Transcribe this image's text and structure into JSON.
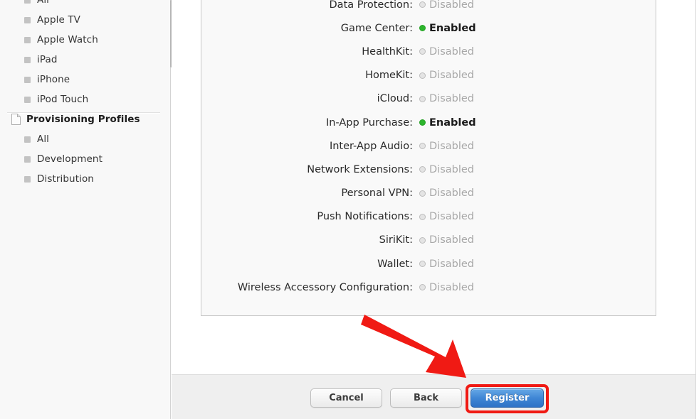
{
  "sidebar": {
    "items": [
      {
        "label": "All",
        "icon": "square-bullet-icon",
        "type": "child"
      },
      {
        "label": "Apple TV",
        "icon": "square-bullet-icon",
        "type": "child"
      },
      {
        "label": "Apple Watch",
        "icon": "square-bullet-icon",
        "type": "child"
      },
      {
        "label": "iPad",
        "icon": "square-bullet-icon",
        "type": "child"
      },
      {
        "label": "iPhone",
        "icon": "square-bullet-icon",
        "type": "child"
      },
      {
        "label": "iPod Touch",
        "icon": "square-bullet-icon",
        "type": "child"
      },
      {
        "label": "Provisioning Profiles",
        "icon": "document-icon",
        "type": "header"
      },
      {
        "label": "All",
        "icon": "square-bullet-icon",
        "type": "child"
      },
      {
        "label": "Development",
        "icon": "square-bullet-icon",
        "type": "child"
      },
      {
        "label": "Distribution",
        "icon": "square-bullet-icon",
        "type": "child"
      }
    ]
  },
  "capabilities": {
    "enabled_label": "Enabled",
    "disabled_label": "Disabled",
    "rows": [
      {
        "name": "Data Protection:",
        "state": "Disabled",
        "enabled": false
      },
      {
        "name": "Game Center:",
        "state": "Enabled",
        "enabled": true
      },
      {
        "name": "HealthKit:",
        "state": "Disabled",
        "enabled": false
      },
      {
        "name": "HomeKit:",
        "state": "Disabled",
        "enabled": false
      },
      {
        "name": "iCloud:",
        "state": "Disabled",
        "enabled": false
      },
      {
        "name": "In-App Purchase:",
        "state": "Enabled",
        "enabled": true
      },
      {
        "name": "Inter-App Audio:",
        "state": "Disabled",
        "enabled": false
      },
      {
        "name": "Network Extensions:",
        "state": "Disabled",
        "enabled": false
      },
      {
        "name": "Personal VPN:",
        "state": "Disabled",
        "enabled": false
      },
      {
        "name": "Push Notifications:",
        "state": "Disabled",
        "enabled": false
      },
      {
        "name": "SiriKit:",
        "state": "Disabled",
        "enabled": false
      },
      {
        "name": "Wallet:",
        "state": "Disabled",
        "enabled": false
      },
      {
        "name": "Wireless Accessory Configuration:",
        "state": "Disabled",
        "enabled": false
      }
    ]
  },
  "footer": {
    "cancel_label": "Cancel",
    "back_label": "Back",
    "register_label": "Register"
  },
  "annotation": {
    "arrow_color": "#f01a14",
    "highlight_color": "#f01a14"
  },
  "colors": {
    "enabled_dot": "#2db52d",
    "disabled_dot": "#e4e4e4",
    "register_blue": "#3f86d5",
    "sidebar_bg": "#f8f8f8",
    "panel_bg": "#f9f9f9"
  }
}
